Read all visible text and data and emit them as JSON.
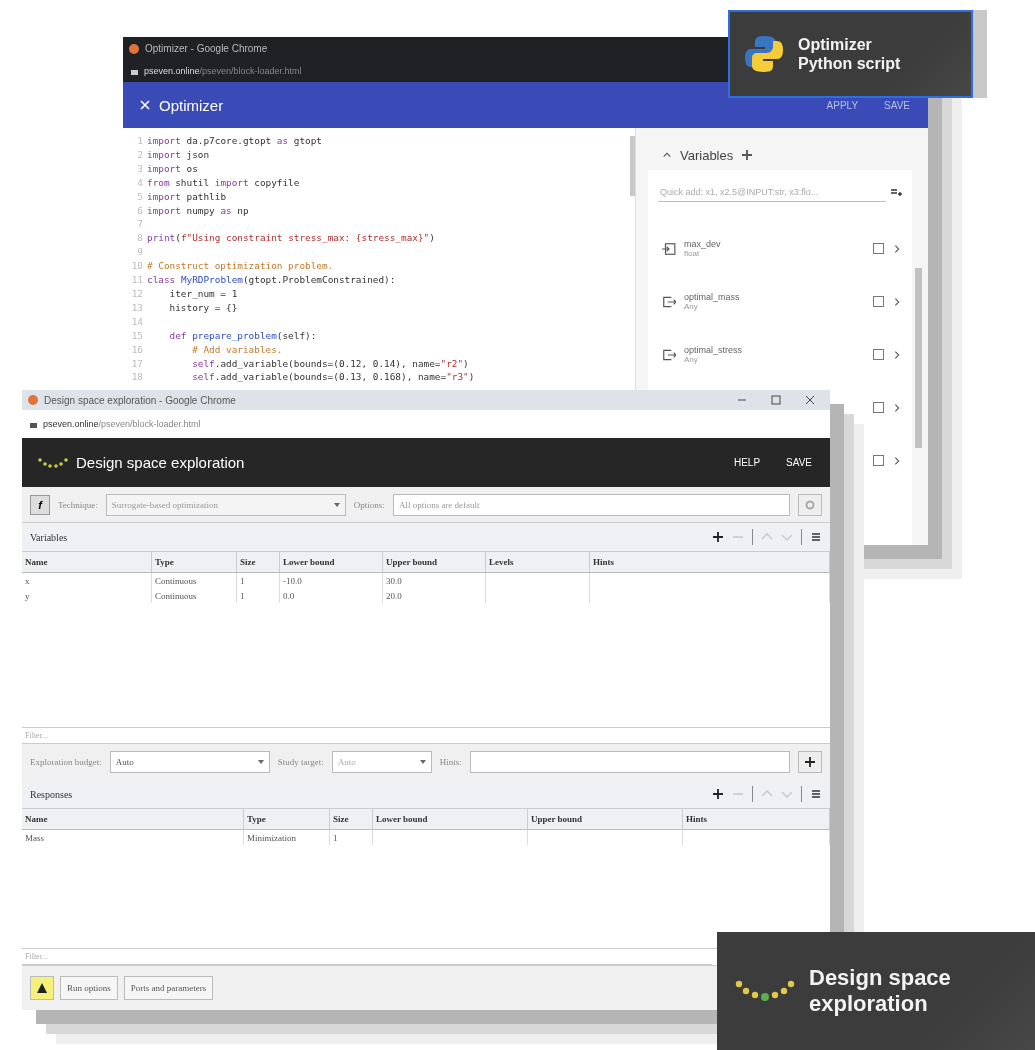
{
  "optimizer_window": {
    "title": "Optimizer - Google Chrome",
    "url_host": "pseven.online",
    "url_path": "/pseven/block-loader.html",
    "header": "Optimizer",
    "actions": [
      "APPLY",
      "SAVE"
    ],
    "code": [
      {
        "n": "1",
        "tokens": [
          {
            "text": "import",
            "kind": "keyword"
          },
          {
            "text": " da.p7core.gtopt ",
            "kind": "plain"
          },
          {
            "text": "as",
            "kind": "keyword"
          },
          {
            "text": " gtopt",
            "kind": "plain"
          }
        ]
      },
      {
        "n": "2",
        "tokens": [
          {
            "text": "import",
            "kind": "keyword"
          },
          {
            "text": " json",
            "kind": "plain"
          }
        ]
      },
      {
        "n": "3",
        "tokens": [
          {
            "text": "import",
            "kind": "keyword"
          },
          {
            "text": " os",
            "kind": "plain"
          }
        ]
      },
      {
        "n": "4",
        "tokens": [
          {
            "text": "from",
            "kind": "keyword"
          },
          {
            "text": " shutil ",
            "kind": "plain"
          },
          {
            "text": "import",
            "kind": "keyword"
          },
          {
            "text": " copyfile",
            "kind": "plain"
          }
        ]
      },
      {
        "n": "5",
        "tokens": [
          {
            "text": "import",
            "kind": "keyword"
          },
          {
            "text": " pathlib",
            "kind": "plain"
          }
        ]
      },
      {
        "n": "6",
        "tokens": [
          {
            "text": "import",
            "kind": "keyword"
          },
          {
            "text": " numpy ",
            "kind": "plain"
          },
          {
            "text": "as",
            "kind": "keyword"
          },
          {
            "text": " np",
            "kind": "plain"
          }
        ]
      },
      {
        "n": "7"
      },
      {
        "n": "8",
        "tokens": [
          {
            "text": "print",
            "kind": "keyword"
          },
          {
            "text": "(",
            "kind": "plain"
          },
          {
            "text": "f\"Using constraint stress_max: {stress_max}\"",
            "kind": "string"
          },
          {
            "text": ")",
            "kind": "plain"
          }
        ]
      },
      {
        "n": "9"
      },
      {
        "n": "10",
        "tokens": [
          {
            "text": "# Construct optimization problem.",
            "kind": "comment"
          }
        ]
      },
      {
        "n": "11",
        "tokens": [
          {
            "text": "class ",
            "kind": "keyword"
          },
          {
            "text": "MyRDProblem",
            "kind": "name"
          },
          {
            "text": "(gtopt.ProblemConstrained):",
            "kind": "plain"
          }
        ]
      },
      {
        "n": "12",
        "tokens": [
          {
            "text": "    iter_num = 1",
            "kind": "plain"
          }
        ]
      },
      {
        "n": "13",
        "tokens": [
          {
            "text": "    history = {}",
            "kind": "plain"
          }
        ]
      },
      {
        "n": "14"
      },
      {
        "n": "15",
        "tokens": [
          {
            "text": "    def ",
            "kind": "keyword"
          },
          {
            "text": "prepare_problem",
            "kind": "name"
          },
          {
            "text": "(self):",
            "kind": "plain"
          }
        ]
      },
      {
        "n": "16",
        "tokens": [
          {
            "text": "        # Add variables.",
            "kind": "comment"
          }
        ]
      },
      {
        "n": "17",
        "tokens": [
          {
            "text": "        self",
            "kind": "keyword"
          },
          {
            "text": ".add_variable(bounds=(0.12, 0.14), name=",
            "kind": "plain"
          },
          {
            "text": "\"r2\"",
            "kind": "string"
          },
          {
            "text": ")",
            "kind": "plain"
          }
        ]
      },
      {
        "n": "18",
        "tokens": [
          {
            "text": "        self",
            "kind": "keyword"
          },
          {
            "text": ".add_variable(bounds=(0.13, 0.168), name=",
            "kind": "plain"
          },
          {
            "text": "\"r3\"",
            "kind": "string"
          },
          {
            "text": ")",
            "kind": "plain"
          }
        ]
      }
    ],
    "variables_panel": {
      "title": "Variables",
      "expanded": true,
      "quick_add_placeholder": "Quick add: x1, x2.5@INPUT:str, x3:flo...",
      "items": [
        {
          "name": "max_dev",
          "type": "float",
          "kind": "input",
          "checked": false
        },
        {
          "name": "optimal_mass",
          "type": "Any",
          "kind": "output",
          "checked": false
        },
        {
          "name": "optimal_stress",
          "type": "Any",
          "kind": "output",
          "checked": false
        },
        {
          "checked": false
        },
        {
          "checked": false
        }
      ]
    }
  },
  "dse_window": {
    "title": "Design space exploration - Google Chrome",
    "url_host": "pseven.online",
    "url_path": "/pseven/block-loader.html",
    "header": "Design space exploration",
    "actions": [
      "HELP",
      "SAVE"
    ],
    "toolbar": {
      "f_button": "f",
      "technique_label": "Technique:",
      "technique_value": "Surrogate-based optimization",
      "options_label": "Options:",
      "options_placeholder": "All options are default"
    },
    "variables": {
      "title": "Variables",
      "columns": [
        "Name",
        "Type",
        "Size",
        "Lower bound",
        "Upper bound",
        "Levels",
        "Hints"
      ],
      "rows": [
        [
          "x",
          "Continuous",
          "1",
          "-10.0",
          "30.0",
          "",
          ""
        ],
        [
          "y",
          "Continuous",
          "1",
          "0.0",
          "20.0",
          "",
          ""
        ]
      ],
      "filter_placeholder": "Filter..."
    },
    "budget": {
      "label": "Exploration budget:",
      "value": "Auto",
      "target_label": "Study target:",
      "target_value": "Auto",
      "hints_label": "Hints:"
    },
    "responses": {
      "title": "Responses",
      "columns": [
        "Name",
        "Type",
        "Size",
        "Lower bound",
        "Upper bound",
        "Hints"
      ],
      "rows": [
        [
          "Mass",
          "Minimization",
          "1",
          "",
          "",
          ""
        ]
      ],
      "filter_placeholder": "Filter..."
    },
    "footer_buttons": [
      "Run options",
      "Ports and parameters"
    ]
  },
  "badges": [
    {
      "kind": "python",
      "title": "Optimizer",
      "subtitle": "Python script"
    },
    {
      "kind": "dse",
      "title": "Design space exploration"
    }
  ]
}
